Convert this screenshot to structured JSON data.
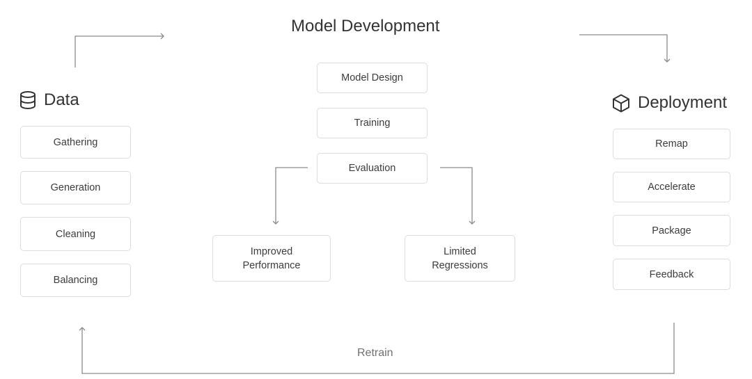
{
  "sections": {
    "data": {
      "title": "Data",
      "icon": "database-icon",
      "steps": [
        "Gathering",
        "Generation",
        "Cleaning",
        "Balancing"
      ]
    },
    "model_development": {
      "title": "Model Development",
      "steps": [
        "Model Design",
        "Training",
        "Evaluation"
      ],
      "outcomes": [
        "Improved Performance",
        "Limited Regressions"
      ]
    },
    "deployment": {
      "title": "Deployment",
      "icon": "cube-icon",
      "steps": [
        "Remap",
        "Accelerate",
        "Package",
        "Feedback"
      ]
    }
  },
  "feedback_loop": {
    "label": "Retrain"
  },
  "colors": {
    "line": "#8a8a8a",
    "box_border": "#dcdcdc",
    "text": "#3c3c3c"
  }
}
